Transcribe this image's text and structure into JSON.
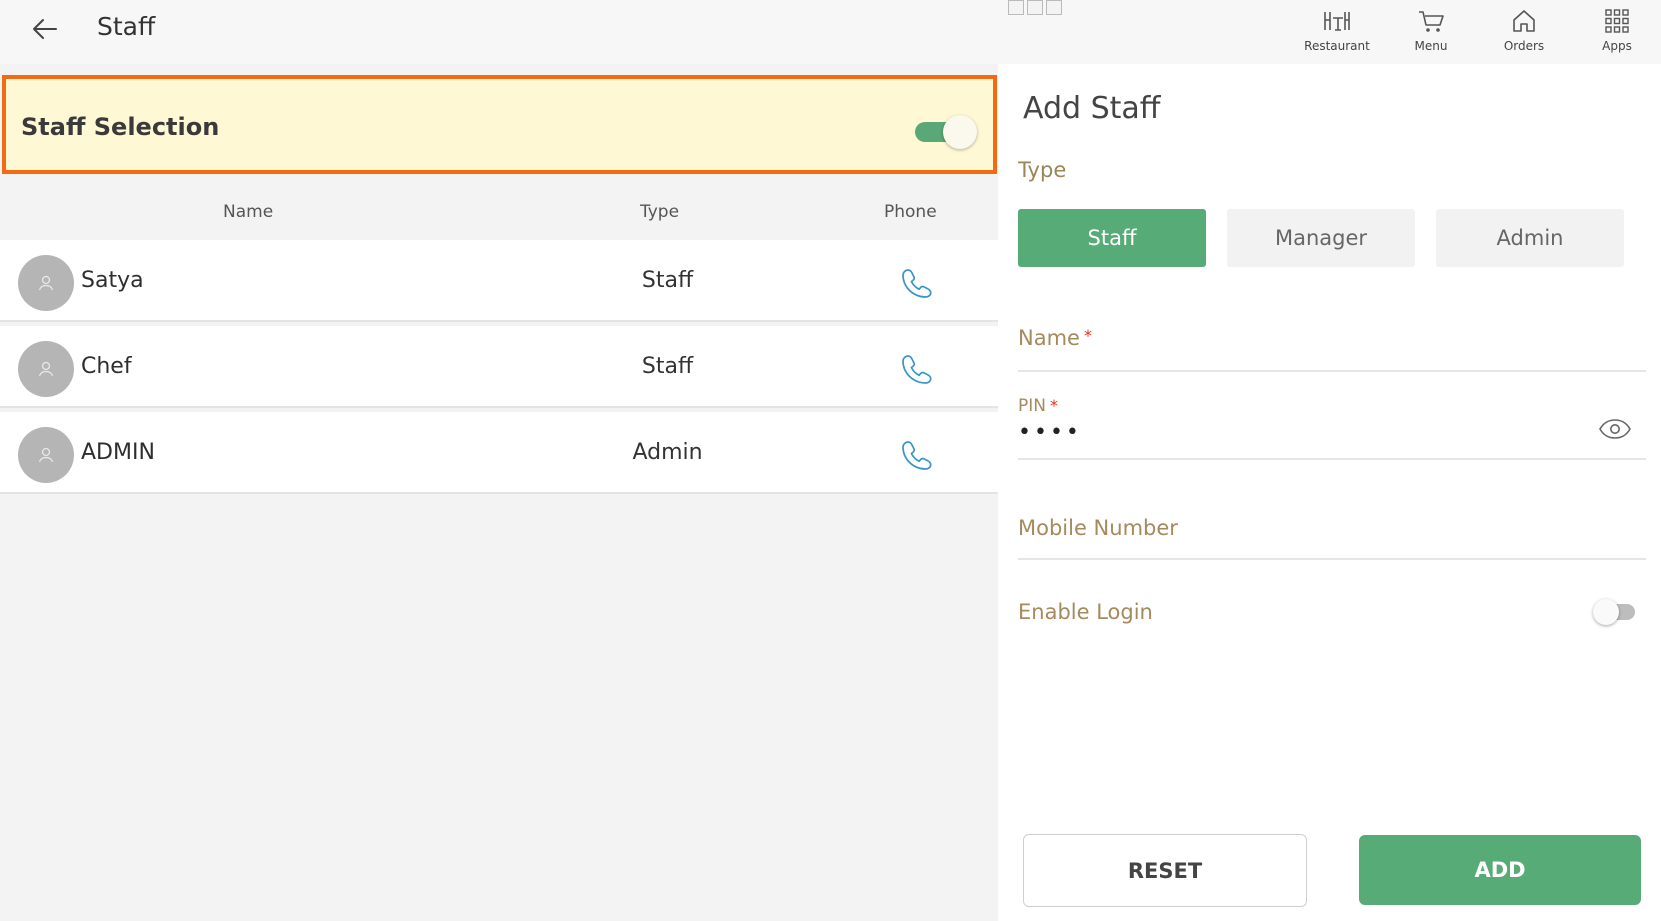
{
  "header": {
    "title": "Staff",
    "back_icon": "arrow-left-icon",
    "nav": [
      {
        "label": "Restaurant",
        "icon": "restaurant-table-icon"
      },
      {
        "label": "Menu",
        "icon": "cart-icon"
      },
      {
        "label": "Orders",
        "icon": "home-icon"
      },
      {
        "label": "Apps",
        "icon": "apps-grid-icon"
      }
    ]
  },
  "selection": {
    "title": "Staff Selection",
    "toggle_on": true,
    "highlight_color": "#f36a12"
  },
  "table": {
    "headers": {
      "name": "Name",
      "type": "Type",
      "phone": "Phone"
    },
    "rows": [
      {
        "name": "Satya",
        "type": "Staff"
      },
      {
        "name": "Chef",
        "type": "Staff"
      },
      {
        "name": "ADMIN",
        "type": "Admin"
      }
    ]
  },
  "form": {
    "title": "Add Staff",
    "type_label": "Type",
    "types": [
      {
        "label": "Staff",
        "active": true
      },
      {
        "label": "Manager",
        "active": false
      },
      {
        "label": "Admin",
        "active": false
      }
    ],
    "name_label": "Name",
    "pin_label": "PIN",
    "pin_value": "••••",
    "required_mark": "*",
    "mobile_label": "Mobile Number",
    "enable_login_label": "Enable Login",
    "enable_login_on": false,
    "reset_label": "RESET",
    "add_label": "ADD"
  },
  "colors": {
    "accent_green": "#57ab76",
    "label_tan": "#a48a5c",
    "selection_bg": "#fff8d5",
    "phone_blue": "#3a96c8"
  }
}
